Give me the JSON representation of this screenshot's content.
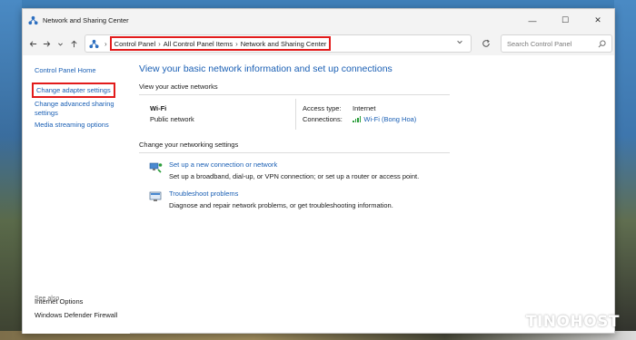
{
  "window": {
    "title": "Network and Sharing Center",
    "controls": {
      "minimize": "—",
      "maximize": "☐",
      "close": "✕"
    }
  },
  "toolbar": {
    "back_icon": "arrow-left-icon",
    "forward_icon": "arrow-right-icon",
    "recent_icon": "chevron-down-icon",
    "up_icon": "arrow-up-icon",
    "breadcrumb": [
      "Control Panel",
      "All Control Panel Items",
      "Network and Sharing Center"
    ],
    "search_placeholder": "Search Control Panel"
  },
  "sidebar": {
    "home": "Control Panel Home",
    "items": [
      "Change adapter settings",
      "Change advanced sharing settings",
      "Media streaming options"
    ],
    "see_also_label": "See also",
    "see_also": [
      "Internet Options",
      "Windows Defender Firewall"
    ]
  },
  "main": {
    "heading": "View your basic network information and set up connections",
    "active_networks_label": "View your active networks",
    "network": {
      "name": "Wi-Fi",
      "type": "Public network",
      "access_type_label": "Access type:",
      "access_type_value": "Internet",
      "connections_label": "Connections:",
      "connections_value": "Wi-Fi (Bong Hoa)"
    },
    "change_settings_label": "Change your networking settings",
    "tasks": [
      {
        "title": "Set up a new connection or network",
        "description": "Set up a broadband, dial-up, or VPN connection; or set up a router or access point."
      },
      {
        "title": "Troubleshoot problems",
        "description": "Diagnose and repair network problems, or get troubleshooting information."
      }
    ]
  },
  "watermark": "TINOHOST",
  "colors": {
    "link": "#1a5fb4",
    "highlight_box": "#e21b1b",
    "signal": "#2a9d3a"
  }
}
